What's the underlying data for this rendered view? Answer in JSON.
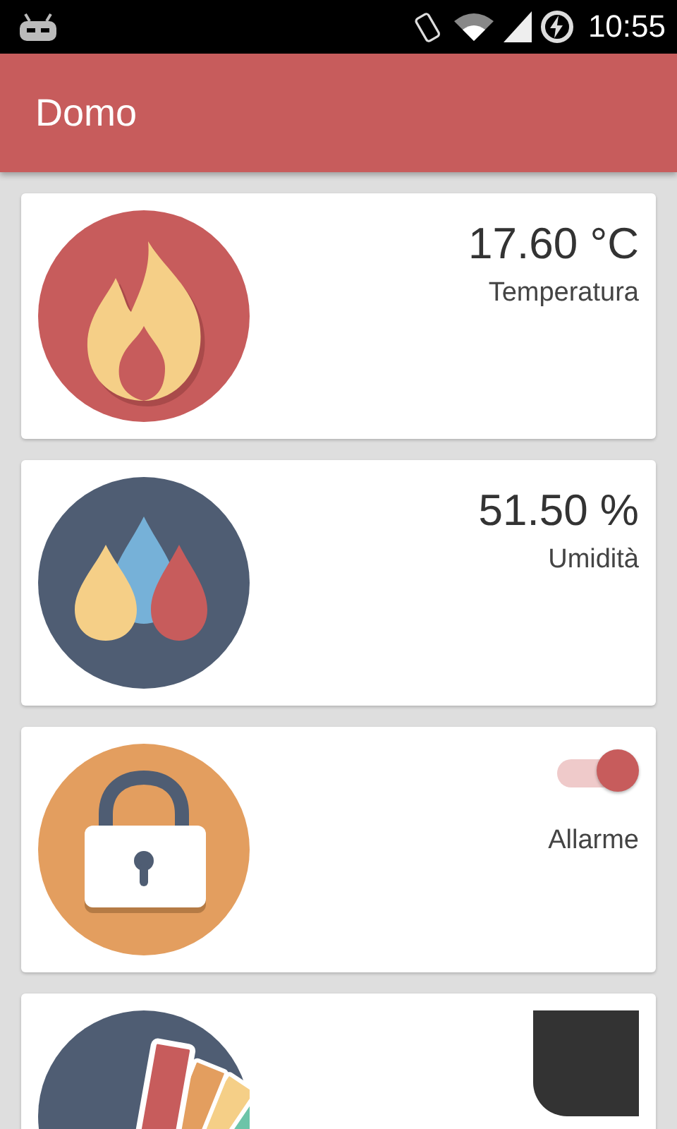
{
  "status_bar": {
    "time": "10:55"
  },
  "app_bar": {
    "title": "Domo"
  },
  "cards": [
    {
      "kind": "temperature",
      "value": "17.60 °C",
      "label": "Temperatura"
    },
    {
      "kind": "humidity",
      "value": "51.50 %",
      "label": "Umidità"
    },
    {
      "kind": "alarm",
      "on": true,
      "label": "Allarme"
    },
    {
      "kind": "color",
      "color": "#333333"
    }
  ]
}
